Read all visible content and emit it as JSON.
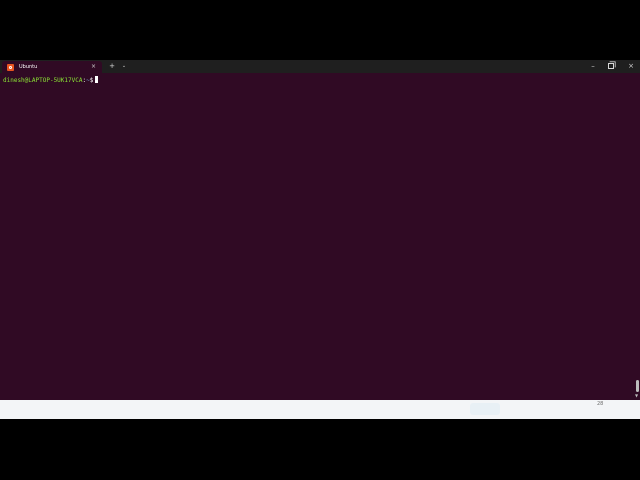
{
  "window": {
    "tab_title": "Ubuntu",
    "tab_close": "×",
    "new_tab": "+",
    "tab_dropdown": "⌄",
    "minimize": "–",
    "close": "×"
  },
  "terminal": {
    "user_host": "dinesh@LAPTOP-5UK17VCA",
    "separator": ":",
    "path": "~",
    "symbol": "$"
  },
  "taskbar": {
    "number": "28"
  },
  "colors": {
    "terminal_bg": "#300a24",
    "prompt_user": "#8ae234",
    "prompt_path": "#729fcf",
    "ubuntu_orange": "#e95420"
  },
  "icons": {
    "tab": "ubuntu-icon",
    "scroll": "chevron-down-icon"
  }
}
